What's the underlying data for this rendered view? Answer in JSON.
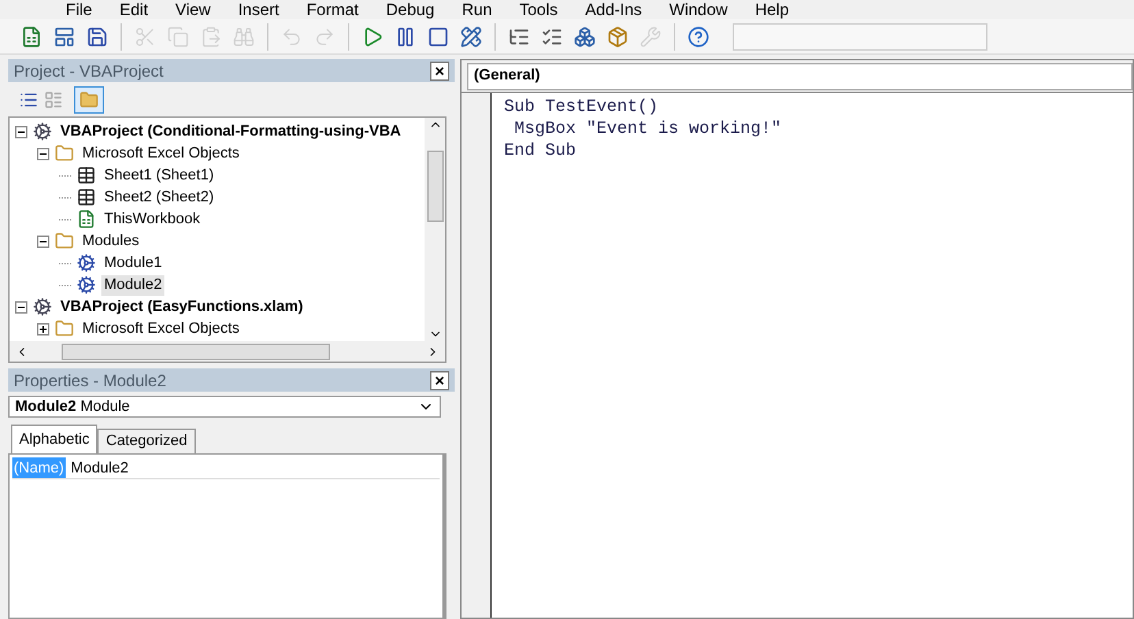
{
  "menu": [
    "File",
    "Edit",
    "View",
    "Insert",
    "Format",
    "Debug",
    "Run",
    "Tools",
    "Add-Ins",
    "Window",
    "Help"
  ],
  "toolbar": [
    {
      "kind": "excel",
      "disabled": false
    },
    {
      "kind": "userform",
      "disabled": false
    },
    {
      "kind": "save",
      "disabled": false
    },
    {
      "kind": "sep"
    },
    {
      "kind": "cut",
      "disabled": true
    },
    {
      "kind": "copy",
      "disabled": true
    },
    {
      "kind": "paste",
      "disabled": true
    },
    {
      "kind": "find",
      "disabled": true
    },
    {
      "kind": "sep"
    },
    {
      "kind": "undo",
      "disabled": true
    },
    {
      "kind": "redo",
      "disabled": true
    },
    {
      "kind": "sep"
    },
    {
      "kind": "run",
      "disabled": false
    },
    {
      "kind": "pause",
      "disabled": false
    },
    {
      "kind": "stop",
      "disabled": false
    },
    {
      "kind": "design",
      "disabled": false
    },
    {
      "kind": "sep"
    },
    {
      "kind": "explorer",
      "disabled": false
    },
    {
      "kind": "props",
      "disabled": false
    },
    {
      "kind": "browser",
      "disabled": false
    },
    {
      "kind": "toolbox",
      "disabled": false
    },
    {
      "kind": "tools",
      "disabled": true
    },
    {
      "kind": "sep"
    },
    {
      "kind": "help",
      "disabled": false
    }
  ],
  "project_panel": {
    "title": "Project - VBAProject",
    "close": "×",
    "tree": [
      {
        "kind": "project",
        "label": "VBAProject (Conditional-Formatting-using-VBA",
        "expanded": true,
        "selected": false,
        "children": [
          {
            "kind": "folder",
            "label": "Microsoft Excel Objects",
            "expanded": true,
            "selected": false,
            "children": [
              {
                "kind": "sheet",
                "label": "Sheet1 (Sheet1)",
                "selected": false
              },
              {
                "kind": "sheet",
                "label": "Sheet2 (Sheet2)",
                "selected": false
              },
              {
                "kind": "workbook",
                "label": "ThisWorkbook",
                "selected": false
              }
            ]
          },
          {
            "kind": "folder",
            "label": "Modules",
            "expanded": true,
            "selected": false,
            "children": [
              {
                "kind": "module",
                "label": "Module1",
                "selected": false
              },
              {
                "kind": "module",
                "label": "Module2",
                "selected": true
              }
            ]
          }
        ]
      },
      {
        "kind": "project",
        "label": "VBAProject (EasyFunctions.xlam)",
        "expanded": true,
        "selected": false,
        "children": [
          {
            "kind": "folder",
            "label": "Microsoft Excel Objects",
            "expanded": false,
            "selected": false
          }
        ]
      }
    ]
  },
  "properties_panel": {
    "title": "Properties - Module2",
    "close": "×",
    "object_name": "Module2",
    "object_type": "Module",
    "tabs": [
      {
        "label": "Alphabetic",
        "selected": true
      },
      {
        "label": "Categorized",
        "selected": false
      }
    ],
    "rows": [
      {
        "name": "(Name)",
        "value": "Module2",
        "selected": true
      }
    ]
  },
  "code_window": {
    "object_dropdown": "(General)",
    "lines": [
      "Sub TestEvent()",
      " MsgBox \"Event is working!\"",
      "End Sub"
    ]
  }
}
